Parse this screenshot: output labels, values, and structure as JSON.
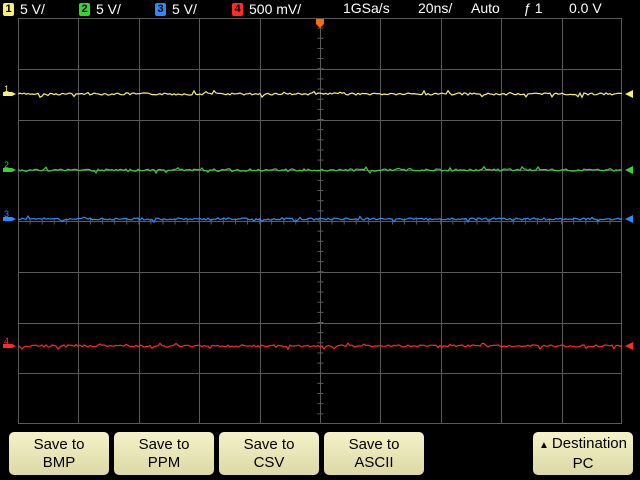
{
  "status_bar": {
    "channels": [
      {
        "number": "1",
        "scale": "5 V/",
        "color": "#f5f07a"
      },
      {
        "number": "2",
        "scale": "5 V/",
        "color": "#33d633"
      },
      {
        "number": "3",
        "scale": "5 V/",
        "color": "#2e8bff"
      },
      {
        "number": "4",
        "scale": "500 mV/",
        "color": "#ff2a2a"
      }
    ],
    "sample_rate": "1GSa/s",
    "timebase": "20ns/",
    "trigger_mode": "Auto",
    "trigger_source": "1",
    "trigger_level": "0.0 V"
  },
  "screen": {
    "grid_color": "#5a5a5a",
    "trigger_marker_color": "#ff6a00",
    "traces": [
      {
        "channel": "1",
        "color": "#f5f07a",
        "name": "channel-1-trace"
      },
      {
        "channel": "2",
        "color": "#33d633",
        "name": "channel-2-trace"
      },
      {
        "channel": "3",
        "color": "#2e8bff",
        "name": "channel-3-trace"
      },
      {
        "channel": "4",
        "color": "#ff2a2a",
        "name": "channel-4-trace"
      }
    ]
  },
  "softkeys": {
    "save_bmp": {
      "line1": "Save to",
      "line2": "BMP"
    },
    "save_ppm": {
      "line1": "Save to",
      "line2": "PPM"
    },
    "save_csv": {
      "line1": "Save to",
      "line2": "CSV"
    },
    "save_ascii": {
      "line1": "Save to",
      "line2": "ASCII"
    },
    "destination": {
      "line1": "Destination",
      "line2": "PC",
      "icon": "up-arrow-icon"
    }
  }
}
